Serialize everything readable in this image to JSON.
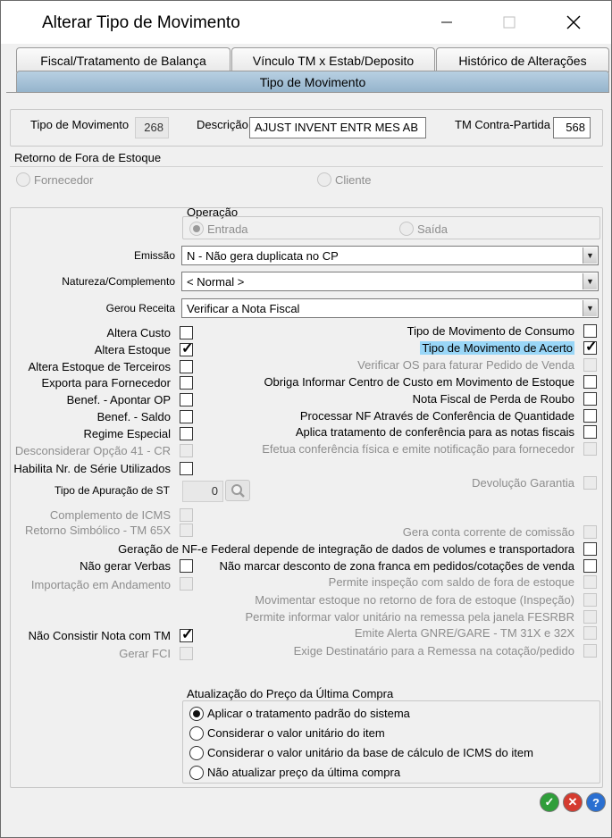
{
  "window": {
    "title": "Alterar Tipo de Movimento"
  },
  "tabs": [
    "Fiscal/Tratamento de Balança",
    "Vínculo TM x Estab/Deposito",
    "Histórico de Alterações"
  ],
  "active_tab": "Tipo de Movimento",
  "header": {
    "tipo_label": "Tipo de Movimento",
    "tipo_value": "268",
    "descricao_label": "Descrição",
    "descricao_value": "AJUST INVENT ENTR MES AB",
    "contra_label": "TM Contra-Partida",
    "contra_value": "568"
  },
  "retorno": {
    "title": "Retorno de Fora de Estoque",
    "opt1": "Fornecedor",
    "opt2": "Cliente"
  },
  "operacao": {
    "title": "Operação",
    "opt1": "Entrada",
    "opt2": "Saída",
    "selected": "Entrada"
  },
  "emissao": {
    "label": "Emissão",
    "value": "N - Não gera duplicata no CP"
  },
  "natureza": {
    "label": "Natureza/Complemento",
    "value": "< Normal >"
  },
  "gerou": {
    "label": "Gerou Receita",
    "value": "Verificar a Nota Fiscal"
  },
  "left_checks": [
    {
      "label": "Altera Custo",
      "checked": false,
      "disabled": false
    },
    {
      "label": "Altera Estoque",
      "checked": true,
      "disabled": false
    },
    {
      "label": "Altera Estoque de Terceiros",
      "checked": false,
      "disabled": false
    },
    {
      "label": "Exporta para Fornecedor",
      "checked": false,
      "disabled": false
    },
    {
      "label": "Benef. - Apontar OP",
      "checked": false,
      "disabled": false
    },
    {
      "label": "Benef. - Saldo",
      "checked": false,
      "disabled": false
    },
    {
      "label": "Regime Especial",
      "checked": false,
      "disabled": false
    },
    {
      "label": "Desconsiderar Opção 41 - CR",
      "checked": false,
      "disabled": true
    },
    {
      "label": "Habilita Nr. de Série Utilizados",
      "checked": false,
      "disabled": false
    }
  ],
  "right_checks": [
    {
      "label": "Tipo de Movimento de Consumo",
      "checked": false,
      "disabled": false
    },
    {
      "label": "Tipo de Movimento de Acerto",
      "checked": true,
      "disabled": false,
      "highlight": true
    },
    {
      "label": "Verificar OS para faturar Pedido de Venda",
      "checked": false,
      "disabled": true
    },
    {
      "label": "Obriga Informar Centro de Custo em Movimento de Estoque",
      "checked": false,
      "disabled": false
    },
    {
      "label": "Nota Fiscal de Perda de Roubo",
      "checked": false,
      "disabled": false
    },
    {
      "label": "Processar NF Através de Conferência de Quantidade",
      "checked": false,
      "disabled": false
    },
    {
      "label": "Aplica tratamento de conferência para as notas fiscais",
      "checked": false,
      "disabled": false
    },
    {
      "label": "Efetua conferência física e emite notificação para fornecedor",
      "checked": false,
      "disabled": true
    }
  ],
  "apuracao": {
    "label": "Tipo de Apuração de ST",
    "value": "0"
  },
  "devolucao": {
    "label": "Devolução Garantia"
  },
  "left_checks2": [
    {
      "label": "Complemento de ICMS",
      "checked": false,
      "disabled": true
    },
    {
      "label": "Retorno Simbólico - TM 65X",
      "checked": false,
      "disabled": true
    }
  ],
  "gera_conta": {
    "label": "Gera conta corrente de comissão"
  },
  "geracao_nfe": {
    "label": "Geração de NF-e Federal depende de integração de dados de volumes e transportadora"
  },
  "nao_gerar_verbas": {
    "label": "Não gerar Verbas"
  },
  "nao_marcar": {
    "label": "Não marcar desconto de zona franca em pedidos/cotações de venda"
  },
  "importacao": {
    "label": "Importação em Andamento"
  },
  "right_checks2": [
    {
      "label": "Permite inspeção com saldo de fora de estoque"
    },
    {
      "label": "Movimentar estoque no retorno de fora de estoque (Inspeção)"
    },
    {
      "label": "Permite informar valor unitário na remessa pela janela FESRBR"
    },
    {
      "label": "Emite Alerta GNRE/GARE - TM 31X e 32X"
    },
    {
      "label": "Exige Destinatário para a Remessa na cotação/pedido"
    }
  ],
  "nao_consistir": {
    "label": "Não Consistir Nota com TM",
    "checked": true
  },
  "gerar_fci": {
    "label": "Gerar FCI"
  },
  "preco": {
    "title": "Atualização do Preço da Última Compra",
    "options": [
      "Aplicar o tratamento padrão do sistema",
      "Considerar o valor unitário do item",
      "Considerar o valor unitário da base de cálculo de ICMS do item",
      "Não atualizar preço da última compra"
    ],
    "selected": 0
  },
  "colors": {
    "ok": "#2f9e3a",
    "cancel": "#d53b2f",
    "help": "#2a6fd1",
    "highlight": "#99d6f7",
    "tab_active": "#a8c4da"
  }
}
